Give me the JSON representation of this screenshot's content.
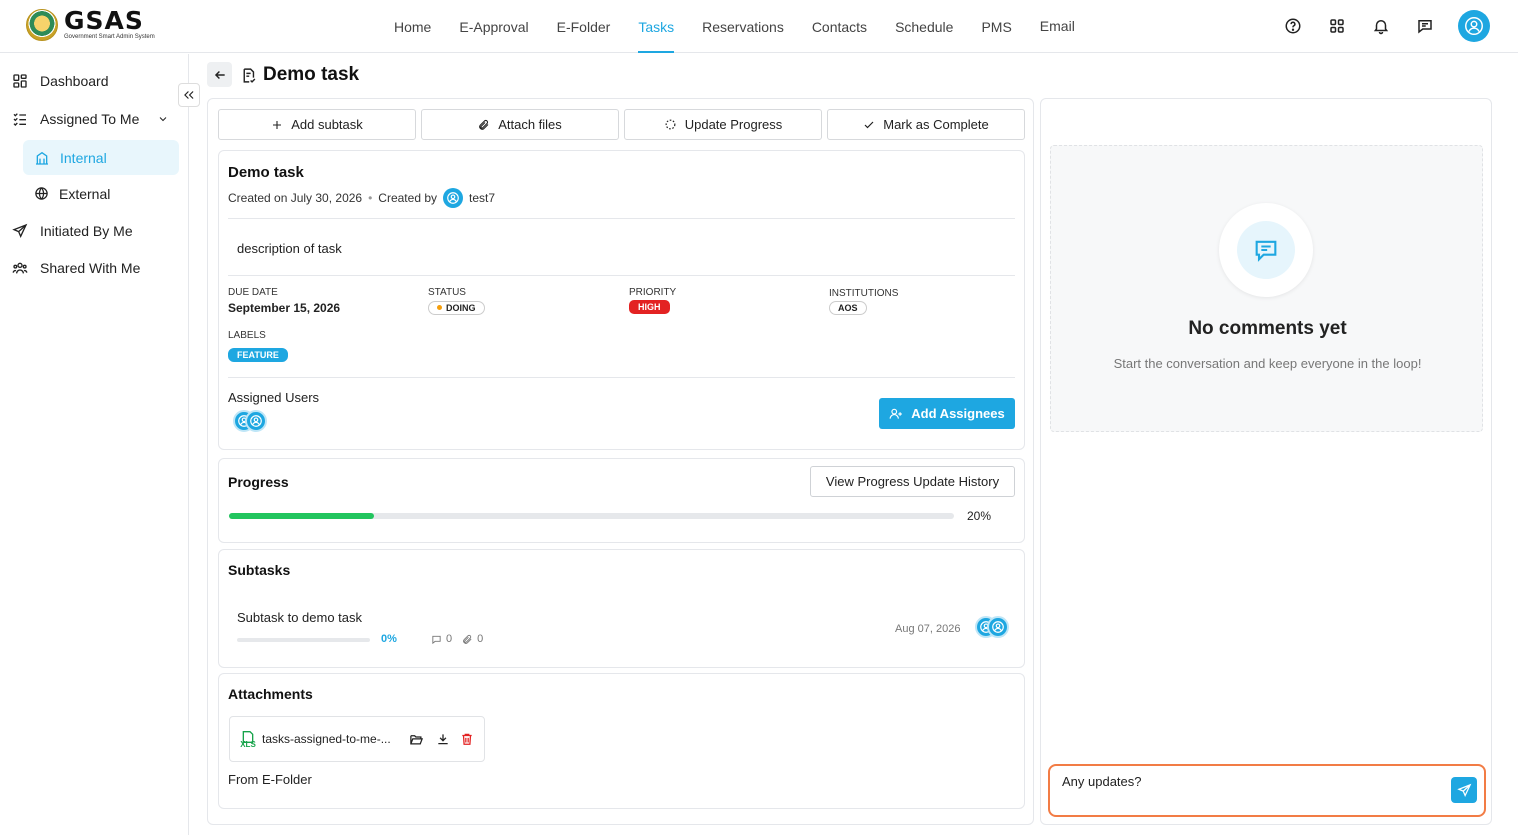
{
  "brand": {
    "name": "GSAS",
    "subtitle": "Government Smart Admin System"
  },
  "nav": {
    "items": [
      {
        "label": "Home"
      },
      {
        "label": "E-Approval"
      },
      {
        "label": "E-Folder"
      },
      {
        "label": "Tasks",
        "active": true
      },
      {
        "label": "Reservations"
      },
      {
        "label": "Contacts"
      },
      {
        "label": "Schedule"
      },
      {
        "label": "PMS"
      },
      {
        "label": "Email"
      }
    ]
  },
  "header_icons": [
    "help-icon",
    "apps-grid-icon",
    "bell-icon",
    "chat-icon",
    "user-avatar-icon"
  ],
  "sidebar": {
    "dashboard": "Dashboard",
    "assigned_to_me": "Assigned To Me",
    "internal": "Internal",
    "external": "External",
    "initiated_by_me": "Initiated By Me",
    "shared_with_me": "Shared With Me"
  },
  "page": {
    "title": "Demo task"
  },
  "actions": {
    "add_subtask": "Add subtask",
    "attach_files": "Attach files",
    "update_progress": "Update Progress",
    "mark_complete": "Mark as Complete"
  },
  "task": {
    "title": "Demo task",
    "created_on": "Created on July 30, 2026",
    "separator": "•",
    "created_by_label": "Created by",
    "created_by": "test7",
    "description": "description of task",
    "due_date_label": "DUE DATE",
    "due_date": "September 15, 2026",
    "status_label": "STATUS",
    "status": "DOING",
    "priority_label": "PRIORITY",
    "priority": "HIGH",
    "institutions_label": "INSTITUTIONS",
    "institution": "AOS",
    "labels_label": "LABELS",
    "label": "FEATURE",
    "assigned_users_label": "Assigned Users",
    "add_assignees": "Add Assignees"
  },
  "progress": {
    "title": "Progress",
    "history_button": "View Progress Update History",
    "value": 20,
    "value_text": "20%"
  },
  "subtasks": {
    "title": "Subtasks",
    "items": [
      {
        "name": "Subtask to demo task",
        "progress": 0,
        "progress_text": "0%",
        "comments": "0",
        "attachments": "0",
        "date": "Aug 07, 2026"
      }
    ]
  },
  "attachments": {
    "title": "Attachments",
    "file_name": "tasks-assigned-to-me-...",
    "file_type": "XLS",
    "from_efolder": "From E-Folder"
  },
  "comments": {
    "empty_title": "No comments yet",
    "empty_text": "Start the conversation and keep everyone in the loop!",
    "input_value": "Any updates?"
  },
  "colors": {
    "accent": "#1ea7e1",
    "success": "#22c55e",
    "danger": "#e32222",
    "focus": "#f27c45"
  }
}
